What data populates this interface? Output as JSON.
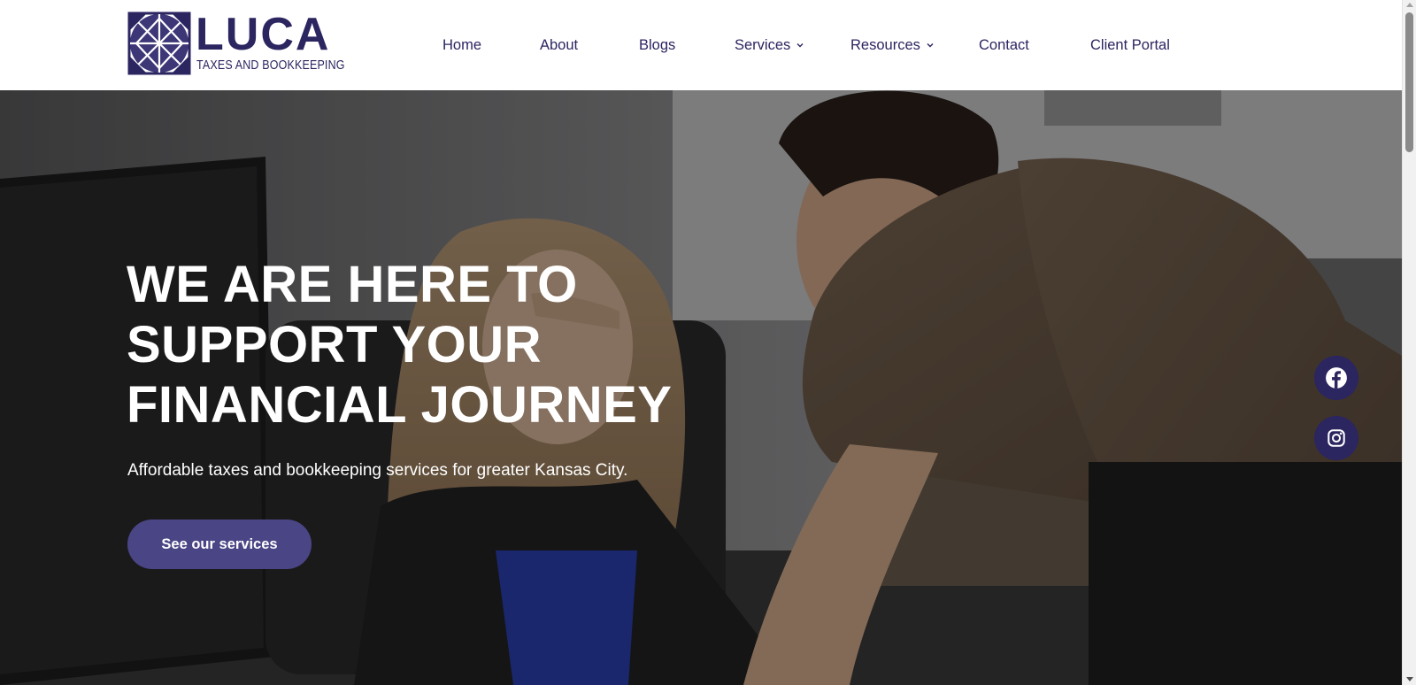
{
  "brand": {
    "name": "LUCA",
    "tagline": "TAXES AND BOOKKEEPING",
    "color": "#2b2560",
    "logo_icon": "compass-star-logo-icon"
  },
  "nav": {
    "items": [
      {
        "label": "Home"
      },
      {
        "label": "About"
      },
      {
        "label": "Blogs"
      },
      {
        "label": "Services",
        "has_dropdown": true
      },
      {
        "label": "Resources",
        "has_dropdown": true
      },
      {
        "label": "Contact"
      },
      {
        "label": "Client Portal"
      }
    ]
  },
  "hero": {
    "title_line1": "WE ARE HERE TO",
    "title_line2": "SUPPORT YOUR",
    "title_line3": "FINANCIAL JOURNEY",
    "subtitle": "Affordable taxes and bookkeeping services for greater Kansas City.",
    "cta_label": "See our services",
    "cta_color": "#4a4585",
    "background": "office photo of two people looking at a computer screen"
  },
  "social": {
    "items": [
      {
        "icon": "facebook-icon"
      },
      {
        "icon": "instagram-icon"
      }
    ],
    "color": "#2b2560"
  }
}
